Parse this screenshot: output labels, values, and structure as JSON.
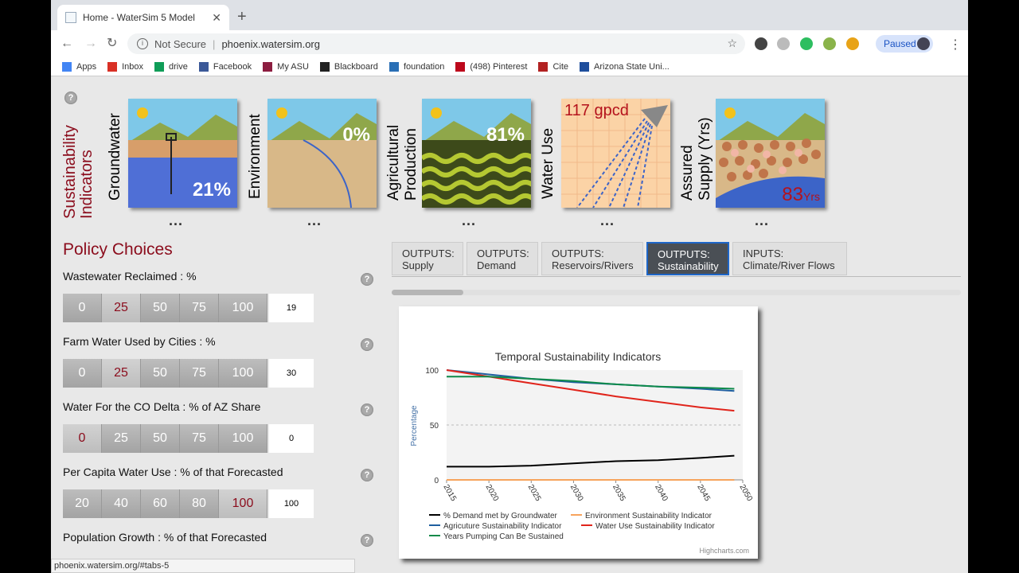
{
  "browser": {
    "tab_title": "Home - WaterSim 5 Model",
    "security_label": "Not Secure",
    "url": "phoenix.watersim.org",
    "profile_label": "Paused",
    "status_url": "phoenix.watersim.org/#tabs-5"
  },
  "bookmarks": [
    {
      "label": "Apps",
      "color": "#4285f4"
    },
    {
      "label": "Inbox",
      "color": "#d93025"
    },
    {
      "label": "drive",
      "color": "#0f9d58"
    },
    {
      "label": "Facebook",
      "color": "#3b5998"
    },
    {
      "label": "My ASU",
      "color": "#8c1d40"
    },
    {
      "label": "Blackboard",
      "color": "#222222"
    },
    {
      "label": "foundation",
      "color": "#2a6fb5"
    },
    {
      "label": "(498) Pinterest",
      "color": "#bd081c"
    },
    {
      "label": "Cite",
      "color": "#b22222"
    },
    {
      "label": "Arizona State Uni...",
      "color": "#1f4e9c"
    }
  ],
  "indicators": {
    "section_title": "Sustainability Indicators",
    "items": [
      {
        "label": "Groundwater",
        "value": "21%"
      },
      {
        "label": "Environment",
        "value": "0%"
      },
      {
        "label": "Agricultural Production",
        "value": "81%"
      },
      {
        "label": "Water Use",
        "value": "117 gpcd"
      },
      {
        "label": "Assured Supply (Yrs)",
        "value": "83",
        "unit": "Yrs"
      }
    ],
    "more": "..."
  },
  "policy": {
    "title": "Policy Choices",
    "controls": [
      {
        "label": "Wastewater Reclaimed : %",
        "options": [
          "0",
          "25",
          "50",
          "75",
          "100"
        ],
        "selected": "25",
        "value": "19"
      },
      {
        "label": "Farm Water Used by Cities : %",
        "options": [
          "0",
          "25",
          "50",
          "75",
          "100"
        ],
        "selected": "25",
        "value": "30"
      },
      {
        "label": "Water For the CO Delta : % of AZ Share",
        "options": [
          "0",
          "25",
          "50",
          "75",
          "100"
        ],
        "selected": "0",
        "value": "0"
      },
      {
        "label": "Per Capita Water Use : % of that Forecasted",
        "options": [
          "20",
          "40",
          "60",
          "80",
          "100"
        ],
        "selected": "100",
        "value": "100"
      },
      {
        "label": "Population Growth : % of that Forecasted"
      }
    ],
    "help": "?"
  },
  "tabs": [
    {
      "line1": "OUTPUTS:",
      "line2": "Supply"
    },
    {
      "line1": "OUTPUTS:",
      "line2": "Demand"
    },
    {
      "line1": "OUTPUTS:",
      "line2": "Reservoirs/Rivers"
    },
    {
      "line1": "OUTPUTS:",
      "line2": "Sustainability"
    },
    {
      "line1": "INPUTS:",
      "line2": "Climate/River Flows"
    }
  ],
  "chart_data": {
    "type": "line",
    "title": "Temporal Sustainability Indicators",
    "ylabel": "Percentage",
    "xlabel": "",
    "xlim": [
      2015,
      2050
    ],
    "ylim": [
      0,
      100
    ],
    "yticks": [
      0,
      50,
      100
    ],
    "xticks": [
      2015,
      2020,
      2025,
      2030,
      2035,
      2040,
      2045,
      2050
    ],
    "x": [
      2015,
      2020,
      2025,
      2030,
      2035,
      2040,
      2045,
      2049
    ],
    "series": [
      {
        "name": "% Demand met by Groundwater",
        "color": "#000000",
        "values": [
          12,
          12,
          13,
          15,
          17,
          18,
          20,
          22
        ]
      },
      {
        "name": "Environment Sustainability Indicator",
        "color": "#f7a35c",
        "values": [
          0,
          0,
          0,
          0,
          0,
          0,
          0,
          0
        ]
      },
      {
        "name": "Agricuture Sustainability Indicator",
        "color": "#1f5fa0",
        "values": [
          100,
          96,
          92,
          89,
          87,
          85,
          83,
          81
        ]
      },
      {
        "name": "Water Use Sustainability Indicator",
        "color": "#e0241b",
        "values": [
          100,
          94,
          88,
          82,
          76,
          71,
          66,
          63
        ]
      },
      {
        "name": "Years Pumping Can Be Sustained",
        "color": "#0e8a4a",
        "values": [
          94,
          94,
          92,
          90,
          87,
          85,
          84,
          83
        ]
      }
    ],
    "grid": true,
    "legend": "bottom",
    "credit": "Highcharts.com"
  }
}
